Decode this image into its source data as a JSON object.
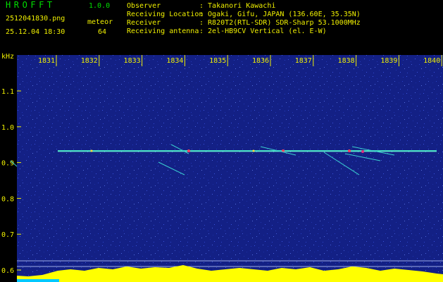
{
  "app": {
    "name": "HROFFT",
    "version": "1.0.0"
  },
  "file": {
    "name": "2512041830.png",
    "datetime": "25.12.04 18:30"
  },
  "event": {
    "type": "meteor",
    "count": "64"
  },
  "info": [
    {
      "label": "Observer",
      "value": ": Takanori Kawachi"
    },
    {
      "label": "Receiving Location",
      "value": ": Ogaki, Gifu, JAPAN (136.60E, 35.35N)"
    },
    {
      "label": "Receiver",
      "value": ": R820T2(RTL-SDR) SDR-Sharp 53.1000MHz"
    },
    {
      "label": "Receiving antenna",
      "value": ": 2el-HB9CV Vertical (el. E-W)"
    }
  ],
  "axes": {
    "y_unit": "kHz",
    "x_ticks": [
      "1831",
      "1832",
      "1833",
      "1834",
      "1835",
      "1836",
      "1837",
      "1838",
      "1839",
      "1840"
    ],
    "y_ticks": [
      "1.1",
      "1.0",
      "0.9",
      "0.8",
      "0.7",
      "0.6"
    ]
  },
  "colors": {
    "background": "#000000",
    "text": "#f0f000",
    "title": "#00e000",
    "noise": "#1a2a9a",
    "echo_line": "#40e0c0",
    "level_bar": "#ffff00"
  }
}
